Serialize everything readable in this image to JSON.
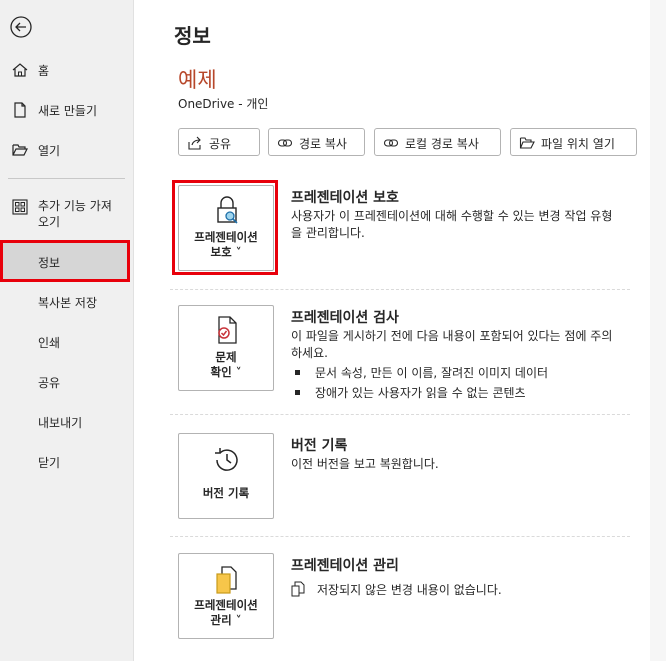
{
  "sidebar": {
    "items": [
      {
        "label": "홈"
      },
      {
        "label": "새로 만들기"
      },
      {
        "label": "열기"
      },
      {
        "label": "추가 기능 가져오기"
      },
      {
        "label": "정보"
      },
      {
        "label": "복사본 저장"
      },
      {
        "label": "인쇄"
      },
      {
        "label": "공유"
      },
      {
        "label": "내보내기"
      },
      {
        "label": "닫기"
      }
    ]
  },
  "main": {
    "page_title": "정보",
    "doc_name": "예제",
    "doc_location": "OneDrive - 개인",
    "actions": [
      {
        "label": "공유",
        "icon": "share-icon"
      },
      {
        "label": "경로 복사",
        "icon": "link-icon"
      },
      {
        "label": "로컬 경로 복사",
        "icon": "link-icon"
      },
      {
        "label": "파일 위치 열기",
        "icon": "folder-open-icon"
      }
    ],
    "protect": {
      "button": "프레젠테이션 보호 ˅",
      "button_line1": "프레젠테이션",
      "button_line2": "보호 ˅",
      "title": "프레젠테이션 보호",
      "desc": "사용자가 이 프레젠테이션에 대해 수행할 수 있는 변경 작업 유형을 관리합니다."
    },
    "inspect": {
      "button_line1": "문제",
      "button_line2": "확인 ˅",
      "title": "프레젠테이션 검사",
      "desc": "이 파일을 게시하기 전에 다음 내용이 포함되어 있다는 점에 주의하세요.",
      "bullets": [
        "문서 속성, 만든 이 이름, 잘려진 이미지 데이터",
        "장애가 있는 사용자가 읽을 수 없는 콘텐츠"
      ]
    },
    "history": {
      "button": "버전 기록",
      "title": "버전 기록",
      "desc": "이전 버전을 보고 복원합니다."
    },
    "manage": {
      "button_line1": "프레젠테이션",
      "button_line2": "관리 ˅",
      "title": "프레젠테이션 관리",
      "desc": "저장되지 않은 변경 내용이 없습니다."
    }
  },
  "colors": {
    "accent": "#b7472a",
    "highlight": "#e8000b",
    "sidebar_bg": "#f0f0f0",
    "selected_bg": "#d6d6d6"
  }
}
